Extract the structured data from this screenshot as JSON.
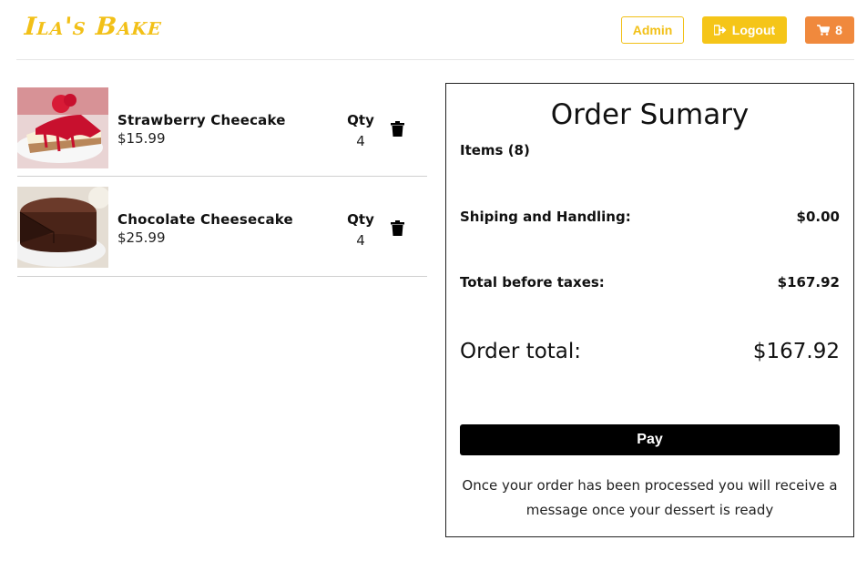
{
  "header": {
    "logo": "Ila's Bake",
    "admin_label": "Admin",
    "logout_label": "Logout",
    "cart_count": "8",
    "colors": {
      "logo": "#f2c017",
      "logout_bg": "#f5c518",
      "cart_bg": "#f0893d"
    }
  },
  "cart": {
    "items": [
      {
        "name": "Strawberry Cheecake",
        "price": "$15.99",
        "qty_label": "Qty",
        "qty": "4",
        "image": "strawberry-cheesecake"
      },
      {
        "name": "Chocolate Cheesecake",
        "price": "$25.99",
        "qty_label": "Qty",
        "qty": "4",
        "image": "chocolate-cheesecake"
      }
    ]
  },
  "summary": {
    "title": "Order Sumary",
    "items_label": "Items (8)",
    "shipping_label": "Shiping and Handling:",
    "shipping_value": "$0.00",
    "before_tax_label": "Total before taxes:",
    "before_tax_value": "$167.92",
    "total_label": "Order total:",
    "total_value": "$167.92",
    "pay_label": "Pay",
    "note": "Once your order has been processed you will receive a message once your dessert is ready"
  }
}
